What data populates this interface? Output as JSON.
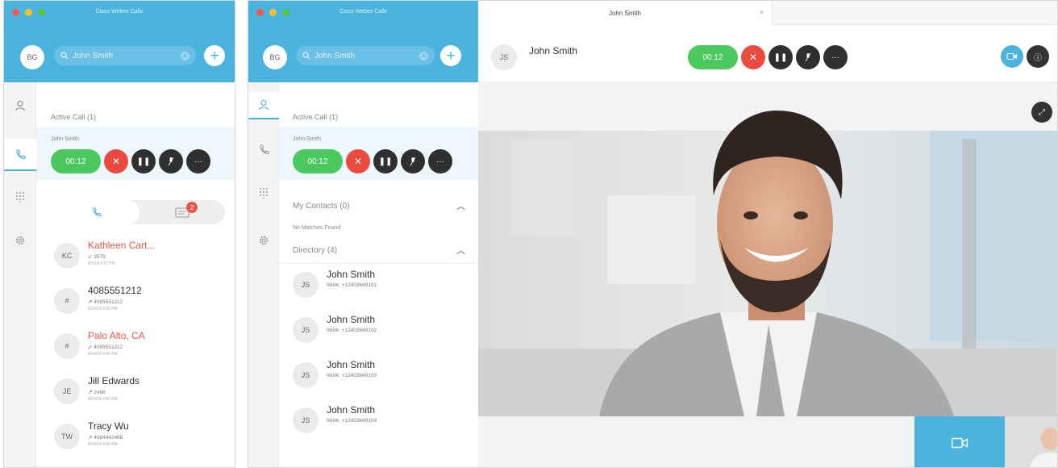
{
  "app_title": "Cisco Webex Calls",
  "user_initials": "BG",
  "search": {
    "value": "John Smith"
  },
  "active_call": {
    "heading": "Active Call (1)",
    "caller": "John Smith",
    "timer": "00:12"
  },
  "recents": [
    {
      "initials": "KC",
      "name": "Kathleen Cart...",
      "missed": true,
      "number": "3579",
      "time": "8/7/18 4:07 PM"
    },
    {
      "initials": "#",
      "name": "4085551212",
      "missed": false,
      "number": "4085551212",
      "time": "8/24/18 4:56 PM"
    },
    {
      "initials": "#",
      "name": "Palo Alto, CA",
      "missed": true,
      "number": "4085551212",
      "time": "8/24/18 4:56 PM"
    },
    {
      "initials": "JE",
      "name": "Jill Edwards",
      "missed": false,
      "number": "2468",
      "time": "8/24/18 4:56 PM"
    },
    {
      "initials": "TW",
      "name": "Tracy Wu",
      "missed": false,
      "number": "4084442468",
      "time": "8/24/18 4:56 PM"
    }
  ],
  "messages_badge": "2",
  "my_contacts": {
    "heading": "My Contacts (0)",
    "empty_text": "No Matches Found"
  },
  "directory": {
    "heading": "Directory (4)",
    "items": [
      {
        "initials": "JS",
        "name": "John Smith",
        "detail": "Work: +12403649101"
      },
      {
        "initials": "JS",
        "name": "John Smith",
        "detail": "Work: +12403649102"
      },
      {
        "initials": "JS",
        "name": "John Smith",
        "detail": "Work: +12403649103"
      },
      {
        "initials": "JS",
        "name": "John Smith",
        "detail": "Work: +12403649104"
      }
    ]
  },
  "call_window": {
    "tab_title": "John Smith",
    "tab_close": "×",
    "header_initials": "JS",
    "header_name": "John Smith",
    "timer": "00:12"
  },
  "icons": {
    "contacts": "person-icon",
    "calls": "phone-icon",
    "dialpad": "dialpad-icon",
    "settings": "gear-icon",
    "end_call": "close-icon",
    "hold": "pause-icon",
    "mute": "microphone-icon",
    "more": "ellipsis-icon",
    "video": "video-camera-icon",
    "expand": "expand-icon"
  },
  "colors": {
    "brand": "#4ab3de",
    "green": "#4cc95e",
    "red": "#ea4b3e",
    "missed": "#e8574b"
  }
}
